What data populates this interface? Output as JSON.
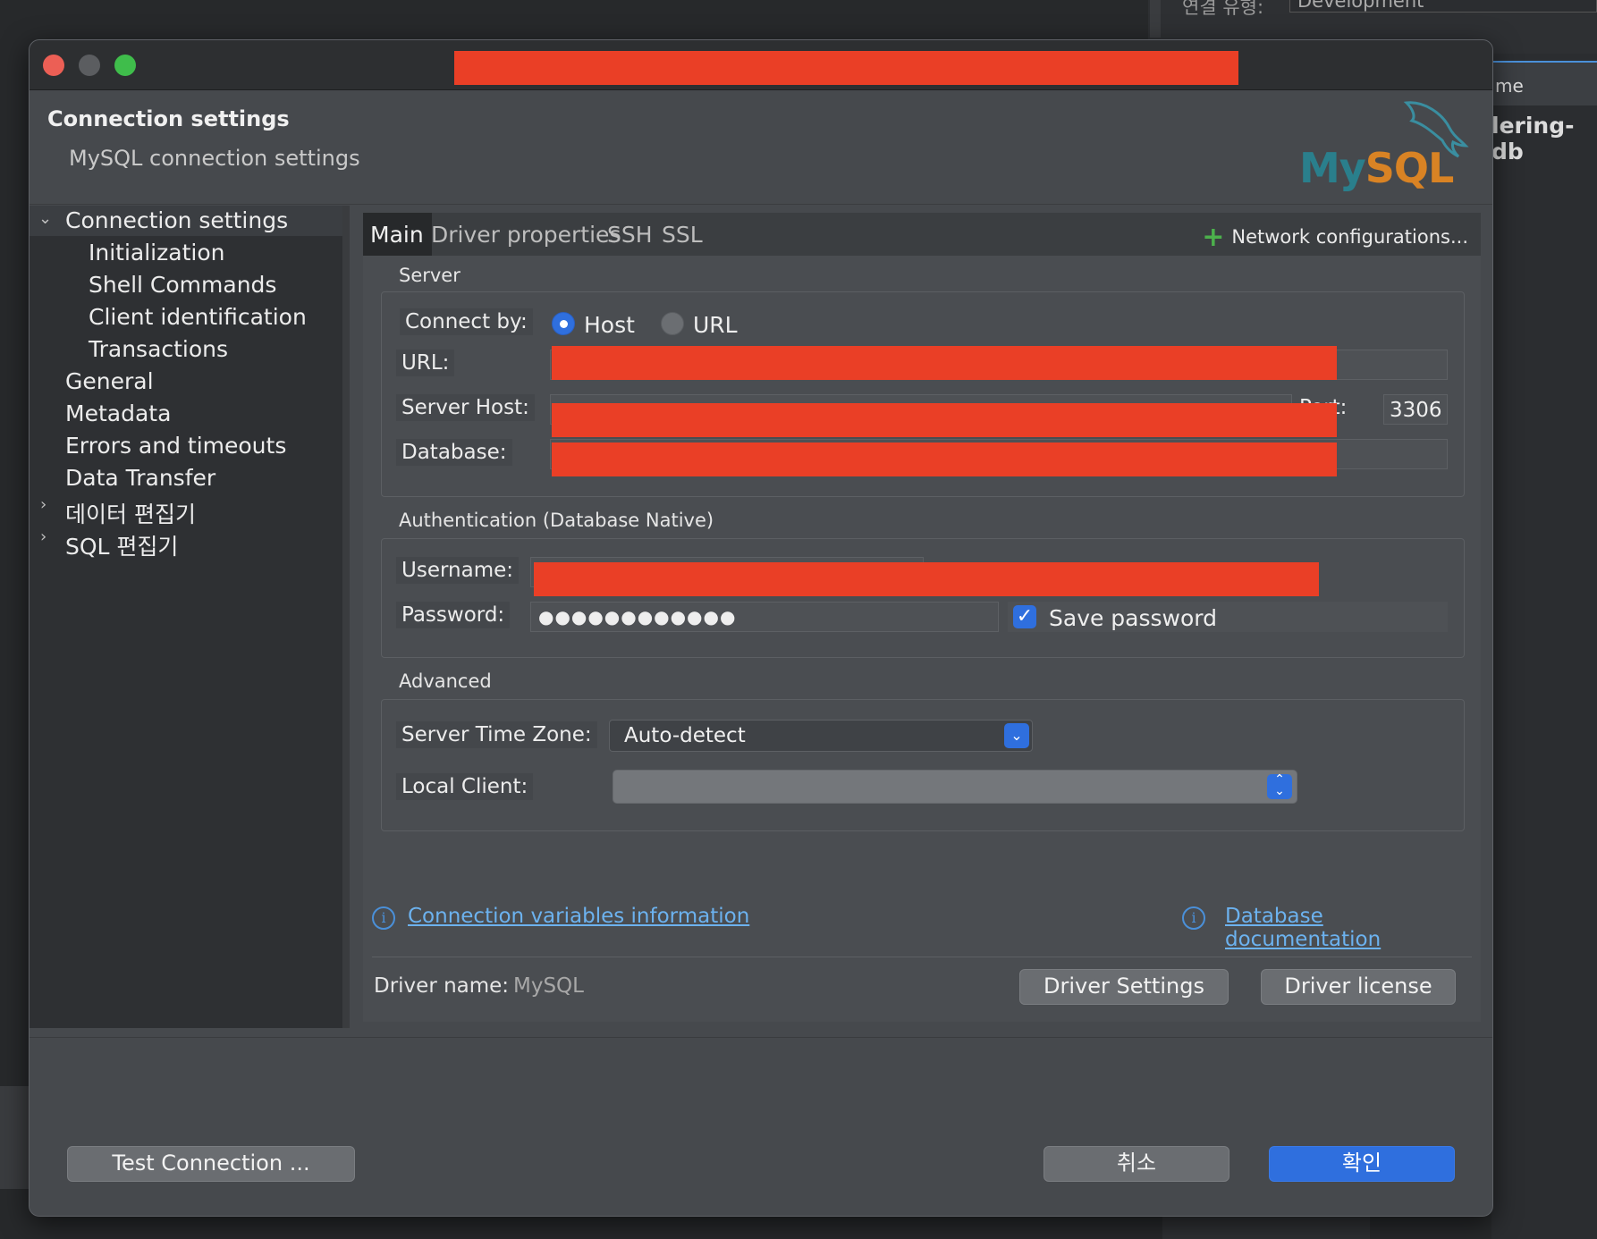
{
  "background": {
    "env_label": "연결 유형:",
    "env_value": "Development",
    "right_tab_label": "me",
    "right_item": "lering-db"
  },
  "dialog": {
    "title_redacted": true,
    "header": {
      "title": "Connection settings",
      "subtitle": "MySQL connection settings",
      "logo_text_my": "My",
      "logo_text_sql": "SQL"
    },
    "sidebar": {
      "items": [
        {
          "label": "Connection settings",
          "expanded": true,
          "selected": true
        },
        {
          "label": "Initialization"
        },
        {
          "label": "Shell Commands"
        },
        {
          "label": "Client identification"
        },
        {
          "label": "Transactions"
        },
        {
          "label": "General"
        },
        {
          "label": "Metadata"
        },
        {
          "label": "Errors and timeouts"
        },
        {
          "label": "Data Transfer"
        },
        {
          "label": "데이터 편집기",
          "collapsed": true
        },
        {
          "label": "SQL 편집기",
          "collapsed": true
        }
      ]
    },
    "tabs": [
      {
        "label": "Main",
        "active": true
      },
      {
        "label": "Driver properties"
      },
      {
        "label": "SSH"
      },
      {
        "label": "SSL"
      }
    ],
    "network_config_label": "Network configurations...",
    "server": {
      "section_label": "Server",
      "connect_by_label": "Connect by:",
      "host_option": "Host",
      "url_option": "URL",
      "url_label": "URL:",
      "server_host_label": "Server Host:",
      "port_label": "Port:",
      "port_value": "3306",
      "database_label": "Database:"
    },
    "auth": {
      "section_label": "Authentication (Database Native)",
      "username_label": "Username:",
      "password_label": "Password:",
      "password_value": "●●●●●●●●●●●●",
      "save_password_label": "Save password",
      "save_password_checked": true
    },
    "advanced": {
      "section_label": "Advanced",
      "timezone_label": "Server Time Zone:",
      "timezone_value": "Auto-detect",
      "local_client_label": "Local Client:",
      "local_client_value": ""
    },
    "links": {
      "conn_vars": "Connection variables information",
      "db_docs": "Database documentation"
    },
    "driver": {
      "name_label": "Driver name:",
      "name_value": "MySQL",
      "settings_button": "Driver Settings",
      "license_button": "Driver license"
    },
    "footer": {
      "test_button": "Test Connection ...",
      "cancel_button": "취소",
      "ok_button": "확인"
    },
    "colors": {
      "accent": "#2f6fde",
      "redaction": "#ea3f26",
      "link": "#6cb2ef"
    }
  }
}
